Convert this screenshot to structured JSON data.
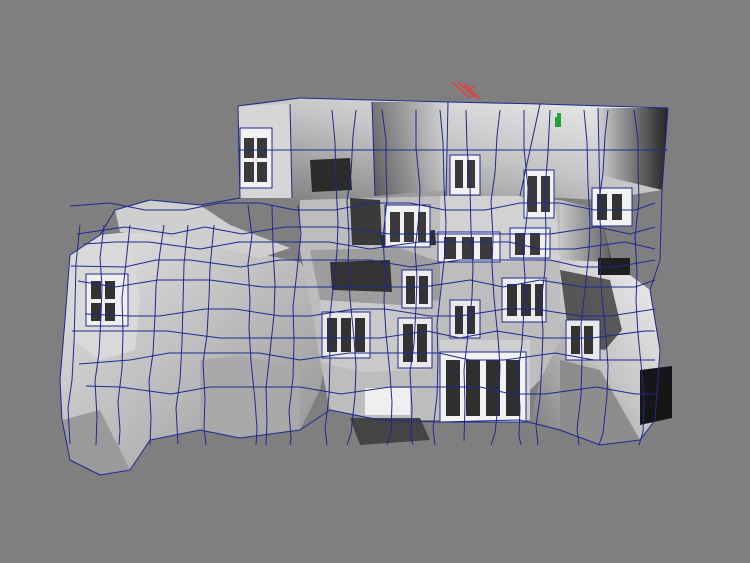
{
  "viewport": {
    "background": "#7f7f7f",
    "wire_color": "#1e2a8c",
    "surface_light": "#e4e4e4",
    "surface_mid": "#a8a8a8",
    "surface_dark": "#2e2e2e",
    "manipulator_color": "#e83a3a",
    "selected_component_color": "#1ea43a"
  },
  "scene": {
    "object": "cliff-building-mesh",
    "display_mode": "wireframe-on-shaded",
    "icons": [
      "light-manipulator-icon",
      "selected-vertex-marker-icon"
    ]
  }
}
